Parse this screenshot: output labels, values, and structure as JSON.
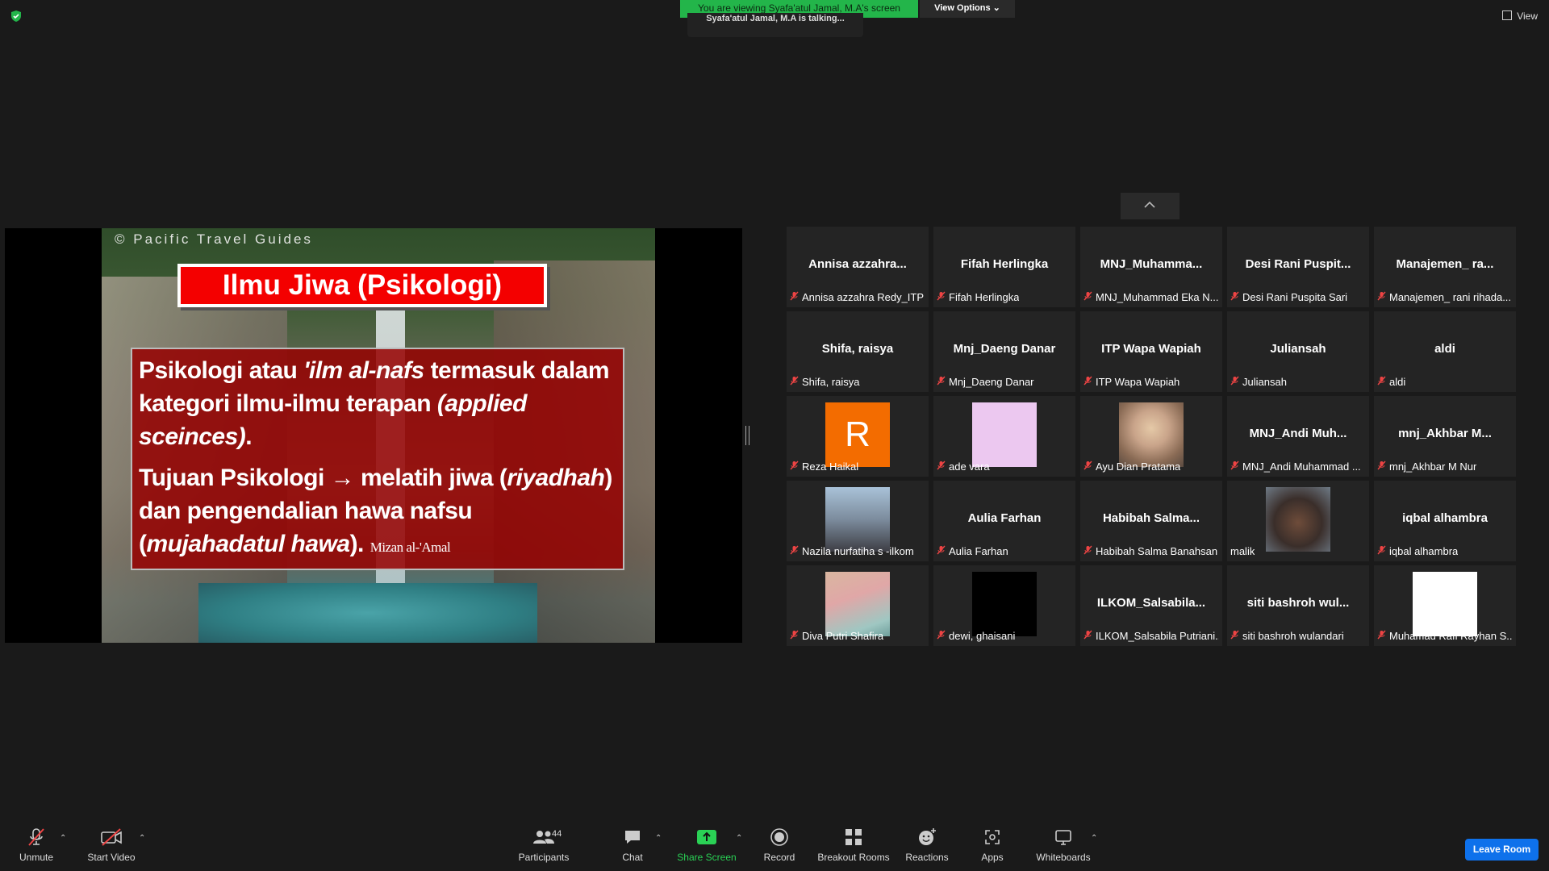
{
  "top": {
    "banner": "You are viewing Syafa'atul Jamal, M.A's screen",
    "view_options": "View Options",
    "talking": "Syafa'atul Jamal, M.A is talking...",
    "view": "View"
  },
  "slide": {
    "watermark": "© Pacific Travel Guides",
    "title": "Ilmu Jiwa (Psikologi)",
    "p1_a": "Psikologi atau ",
    "p1_b": "'ilm al-nafs",
    "p1_c": " termasuk dalam kategori ilmu-ilmu terapan ",
    "p1_d": "(applied sceinces)",
    "p1_e": ".",
    "p2_a": "Tujuan Psikologi → melatih jiwa (",
    "p2_b": "riyadhah",
    "p2_c": ") dan pengendalian hawa nafsu (",
    "p2_d": "mujahadatul hawa",
    "p2_e": "). ",
    "source": "Mizan al-'Amal"
  },
  "gallery": {
    "tiles": [
      {
        "name": "Annisa  azzahra...",
        "label": "Annisa azzahra Redy_ITP",
        "muted": true
      },
      {
        "name": "Fifah Herlingka",
        "label": "Fifah Herlingka",
        "muted": true
      },
      {
        "name": "MNJ_Muhamma...",
        "label": "MNJ_Muhammad Eka N...",
        "muted": true
      },
      {
        "name": "Desi  Rani  Puspit...",
        "label": "Desi Rani Puspita Sari",
        "muted": true
      },
      {
        "name": "Manajemen_ ra...",
        "label": "Manajemen_ rani rihada...",
        "muted": true
      },
      {
        "name": "Shifa, raisya",
        "label": "Shifa, raisya",
        "muted": true
      },
      {
        "name": "Mnj_Daeng Danar",
        "label": "Mnj_Daeng Danar",
        "muted": true
      },
      {
        "name": "ITP Wapa Wapiah",
        "label": "ITP Wapa Wapiah",
        "muted": true
      },
      {
        "name": "Juliansah",
        "label": "Juliansah",
        "muted": true
      },
      {
        "name": "aldi",
        "label": "aldi",
        "muted": true
      },
      {
        "name": "",
        "label": "Reza Haikal",
        "muted": true,
        "avatar": "R"
      },
      {
        "name": "",
        "label": "ade vara",
        "muted": true
      },
      {
        "name": "",
        "label": "Ayu Dian Pratama",
        "muted": true
      },
      {
        "name": "MNJ_Andi  Muh...",
        "label": "MNJ_Andi Muhammad ...",
        "muted": true
      },
      {
        "name": "mnj_Akhbar  M...",
        "label": "mnj_Akhbar M Nur",
        "muted": true
      },
      {
        "name": "",
        "label": "Nazila nurfatiha s -ilkom",
        "muted": true
      },
      {
        "name": "Aulia Farhan",
        "label": "Aulia Farhan",
        "muted": true
      },
      {
        "name": "Habibah  Salma...",
        "label": "Habibah Salma Banahsan",
        "muted": true
      },
      {
        "name": "",
        "label": "malik",
        "muted": false
      },
      {
        "name": "iqbal alhambra",
        "label": "iqbal alhambra",
        "muted": true
      },
      {
        "name": "",
        "label": "Diva Putri Shafira",
        "muted": true
      },
      {
        "name": "",
        "label": "dewi, ghaisani",
        "muted": true
      },
      {
        "name": "ILKOM_Salsabila...",
        "label": "ILKOM_Salsabila Putriani...",
        "muted": true
      },
      {
        "name": "siti  bashroh  wul...",
        "label": "siti bashroh wulandari",
        "muted": true
      },
      {
        "name": "",
        "label": "Muhamad Rafi Rayhan S...",
        "muted": true
      }
    ]
  },
  "toolbar": {
    "unmute": "Unmute",
    "start_video": "Start Video",
    "participants": "Participants",
    "participants_count": "44",
    "chat": "Chat",
    "share_screen": "Share Screen",
    "record": "Record",
    "breakout": "Breakout Rooms",
    "reactions": "Reactions",
    "apps": "Apps",
    "whiteboards": "Whiteboards",
    "leave": "Leave Room"
  },
  "colors": {
    "banner_green": "#23b54a",
    "leave_blue": "#0e71eb",
    "muted_red": "#e44444",
    "slide_title_red": "#f40000"
  }
}
